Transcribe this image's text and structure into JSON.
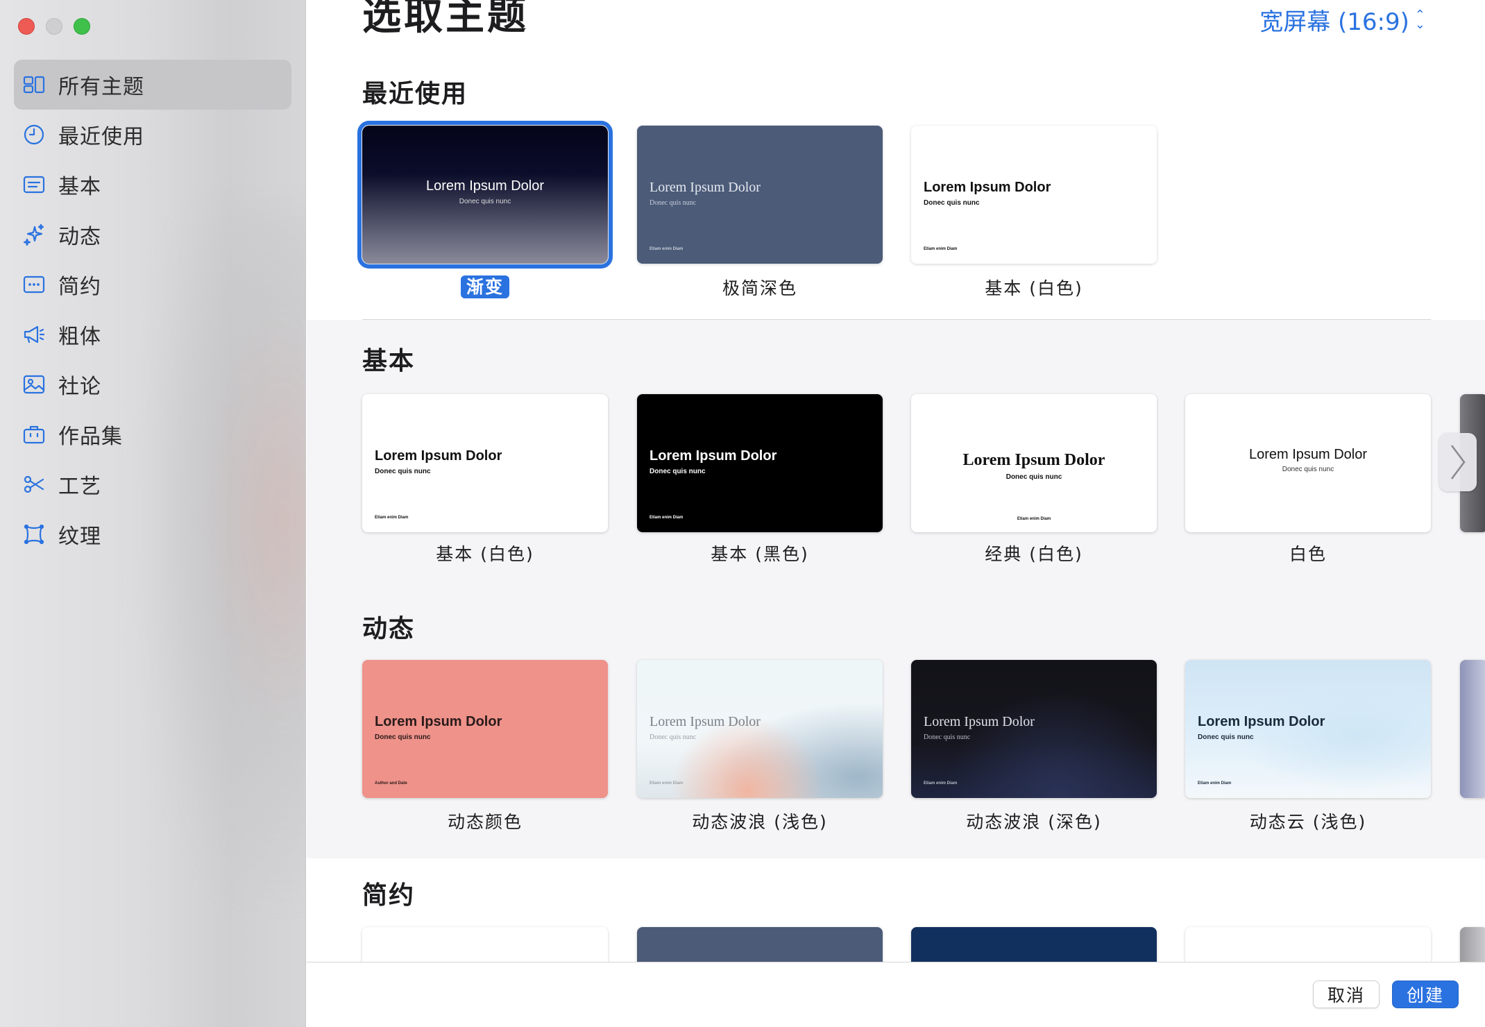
{
  "window": {
    "title": "选取主题"
  },
  "sidebar": {
    "items": [
      {
        "label": "所有主题",
        "icon": "grid-icon",
        "selected": true
      },
      {
        "label": "最近使用",
        "icon": "clock-icon"
      },
      {
        "label": "基本",
        "icon": "slide-basic-icon"
      },
      {
        "label": "动态",
        "icon": "sparkles-icon"
      },
      {
        "label": "简约",
        "icon": "slide-dots-icon"
      },
      {
        "label": "粗体",
        "icon": "megaphone-icon"
      },
      {
        "label": "社论",
        "icon": "photo-icon"
      },
      {
        "label": "作品集",
        "icon": "briefcase-icon"
      },
      {
        "label": "工艺",
        "icon": "scissors-icon"
      },
      {
        "label": "纹理",
        "icon": "frame-icon"
      }
    ]
  },
  "header": {
    "aspect": "宽屏幕 (16:9)"
  },
  "sections": {
    "recent": {
      "title": "最近使用",
      "themes": [
        {
          "name": "渐变",
          "thumb_title": "Lorem Ipsum Dolor",
          "thumb_sub": "Donec quis nunc",
          "thumb_foot": ""
        },
        {
          "name": "极简深色",
          "thumb_title": "Lorem Ipsum Dolor",
          "thumb_sub": "Donec quis nunc",
          "thumb_foot": "Etiam enim Diam"
        },
        {
          "name": "基本 (白色)",
          "thumb_title": "Lorem Ipsum Dolor",
          "thumb_sub": "Donec quis nunc",
          "thumb_foot": "Etiam enim Diam"
        }
      ]
    },
    "basic": {
      "title": "基本",
      "themes": [
        {
          "name": "基本 (白色)",
          "thumb_title": "Lorem Ipsum Dolor",
          "thumb_sub": "Donec quis nunc",
          "thumb_foot": "Etiam enim Diam"
        },
        {
          "name": "基本 (黑色)",
          "thumb_title": "Lorem Ipsum Dolor",
          "thumb_sub": "Donec quis nunc",
          "thumb_foot": "Etiam enim Diam"
        },
        {
          "name": "经典 (白色)",
          "thumb_title": "Lorem Ipsum Dolor",
          "thumb_sub": "Donec quis nunc",
          "thumb_foot": "Etiam enim Diam"
        },
        {
          "name": "白色",
          "thumb_title": "Lorem Ipsum Dolor",
          "thumb_sub": "Donec quis nunc",
          "thumb_foot": ""
        }
      ]
    },
    "dynamic": {
      "title": "动态",
      "themes": [
        {
          "name": "动态颜色",
          "thumb_title": "Lorem Ipsum Dolor",
          "thumb_sub": "Donec quis nunc",
          "thumb_foot": "Author and Date"
        },
        {
          "name": "动态波浪 (浅色)",
          "thumb_title": "Lorem Ipsum Dolor",
          "thumb_sub": "Donec quis nunc",
          "thumb_foot": "Etiam enim Diam"
        },
        {
          "name": "动态波浪 (深色)",
          "thumb_title": "Lorem Ipsum Dolor",
          "thumb_sub": "Donec quis nunc",
          "thumb_foot": "Etiam enim Diam"
        },
        {
          "name": "动态云 (浅色)",
          "thumb_title": "Lorem Ipsum Dolor",
          "thumb_sub": "Donec quis nunc",
          "thumb_foot": "Etiam enim Diam"
        }
      ]
    },
    "simple": {
      "title": "简约"
    }
  },
  "footer": {
    "cancel": "取消",
    "create": "创建"
  },
  "colors": {
    "accent": "#2a72e0",
    "sidebar_bg": "#dcdcde",
    "section_gray": "#f5f5f7"
  }
}
